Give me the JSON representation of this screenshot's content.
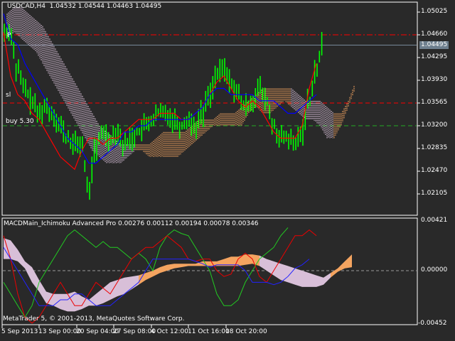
{
  "header": {
    "symbol": "USDCAD",
    "timeframe": "H4",
    "ohlc": "1.04532 1.04544 1.04463 1.04495"
  },
  "labels": {
    "p_marker": "P",
    "sl": "sl",
    "buy": "buy 5.30"
  },
  "price_axis": [
    "1.05025",
    "1.04660",
    "1.04295",
    "1.03930",
    "1.03565",
    "1.03200",
    "1.02835",
    "1.02470",
    "1.02105"
  ],
  "current_price": "1.04495",
  "indicator": {
    "title": "MACDMain_Ichimoku Advanced Pro 0.00276 0.00112 0.00194 0.00078 0.00346",
    "axis": [
      "0.00421",
      "0.00000",
      "-0.00452"
    ]
  },
  "copyright": "MetaTrader 5, © 2001-2013, MetaQuotes Software Corp.",
  "time_axis": [
    "5 Sep 2013",
    "13 Sep 00:00",
    "20 Sep 04:00",
    "27 Sep 08:00",
    "4 Oct 12:00",
    "11 Oct 16:00",
    "18 Oct 20:00"
  ],
  "colors": {
    "bg": "#292929",
    "bars": "#00ff00",
    "tenkan": "#ff0000",
    "kijun": "#0000ff",
    "pink": "#d8bfd8",
    "orange": "#f4a460",
    "grid": "#ffffff"
  },
  "chart_data": {
    "type": "line",
    "price_levels": {
      "dashdot_red": 1.0466,
      "current": 1.04495,
      "sl": 1.03565,
      "buy": 1.032
    },
    "price_ylim": [
      1.019,
      1.053
    ],
    "closes": [
      1.047,
      1.041,
      1.038,
      1.036,
      1.034,
      1.035,
      1.034,
      1.032,
      1.03,
      1.029,
      1.029,
      1.022,
      1.028,
      1.031,
      1.03,
      1.031,
      1.029,
      1.03,
      1.031,
      1.032,
      1.033,
      1.034,
      1.034,
      1.033,
      1.032,
      1.033,
      1.032,
      1.034,
      1.037,
      1.04,
      1.041,
      1.039,
      1.037,
      1.035,
      1.036,
      1.038,
      1.036,
      1.032,
      1.03,
      1.03,
      1.029,
      1.031,
      1.036,
      1.041,
      1.0449
    ],
    "tenkan": [
      1.047,
      1.04,
      1.037,
      1.036,
      1.034,
      1.033,
      1.031,
      1.029,
      1.027,
      1.026,
      1.025,
      1.028,
      1.03,
      1.03,
      1.029,
      1.03,
      1.03,
      1.031,
      1.032,
      1.033,
      1.033,
      1.033,
      1.034,
      1.034,
      1.034,
      1.033,
      1.033,
      1.034,
      1.035,
      1.037,
      1.039,
      1.04,
      1.038,
      1.036,
      1.035,
      1.036,
      1.035,
      1.033,
      1.031,
      1.03,
      1.03,
      1.03,
      1.032,
      1.038,
      1.042
    ],
    "kijun": [
      1.05,
      1.046,
      1.045,
      1.042,
      1.04,
      1.038,
      1.036,
      1.034,
      1.032,
      1.03,
      1.029,
      1.028,
      1.026,
      1.026,
      1.027,
      1.028,
      1.029,
      1.031,
      1.031,
      1.032,
      1.032,
      1.033,
      1.033,
      1.033,
      1.033,
      1.033,
      1.033,
      1.034,
      1.035,
      1.037,
      1.038,
      1.038,
      1.037,
      1.037,
      1.037,
      1.037,
      1.036,
      1.036,
      1.036,
      1.035,
      1.034,
      1.034,
      1.035,
      1.036,
      1.037
    ],
    "kumo_upper": [
      1.05,
      1.051,
      1.051,
      1.05,
      1.049,
      1.048,
      1.046,
      1.044,
      1.042,
      1.04,
      1.038,
      1.036,
      1.034,
      1.032,
      1.031,
      1.03,
      1.029,
      1.029,
      1.029,
      1.029,
      1.029,
      1.03,
      1.031,
      1.031,
      1.031,
      1.031,
      1.032,
      1.033,
      1.033,
      1.033,
      1.034,
      1.034,
      1.034,
      1.035,
      1.036,
      1.037,
      1.038,
      1.038,
      1.038,
      1.038,
      1.038,
      1.037,
      1.036,
      1.036,
      1.036,
      1.035,
      1.034,
      1.034,
      1.036,
      1.039
    ],
    "kumo_lower": [
      1.046,
      1.047,
      1.046,
      1.045,
      1.044,
      1.042,
      1.04,
      1.038,
      1.036,
      1.034,
      1.032,
      1.03,
      1.028,
      1.027,
      1.026,
      1.026,
      1.026,
      1.027,
      1.028,
      1.028,
      1.027,
      1.027,
      1.027,
      1.027,
      1.027,
      1.028,
      1.029,
      1.03,
      1.031,
      1.032,
      1.032,
      1.032,
      1.032,
      1.032,
      1.034,
      1.035,
      1.034,
      1.034,
      1.035,
      1.036,
      1.035,
      1.034,
      1.033,
      1.033,
      1.032,
      1.03,
      1.03,
      1.032,
      1.035,
      1.038
    ],
    "kumo_segments": [
      {
        "from": 0,
        "to": 18,
        "color": "pink"
      },
      {
        "from": 18,
        "to": 40,
        "color": "orange"
      },
      {
        "from": 40,
        "to": 46,
        "color": "pink"
      },
      {
        "from": 46,
        "to": 49,
        "color": "orange"
      }
    ],
    "macd_ylim": [
      -0.00452,
      0.00421
    ],
    "macd_green": [
      -0.001,
      -0.002,
      -0.003,
      -0.004,
      -0.003,
      -0.001,
      0.0,
      0.001,
      0.002,
      0.003,
      0.0035,
      0.003,
      0.0025,
      0.002,
      0.0025,
      0.002,
      0.002,
      0.0015,
      0.001,
      0.0015,
      0.001,
      0.0,
      0.002,
      0.003,
      0.0035,
      0.0032,
      0.003,
      0.002,
      0.001,
      0.0,
      -0.002,
      -0.003,
      -0.003,
      -0.0025,
      -0.001,
      0.0,
      0.001,
      0.0015,
      0.002,
      0.003,
      0.0037
    ],
    "macd_red": [
      0.003,
      0.001,
      -0.002,
      -0.004,
      -0.0045,
      -0.004,
      -0.003,
      -0.002,
      -0.001,
      -0.002,
      -0.003,
      -0.003,
      -0.002,
      -0.001,
      -0.0015,
      -0.002,
      -0.001,
      0.0,
      0.001,
      0.0015,
      0.002,
      0.002,
      0.0025,
      0.003,
      0.0025,
      0.002,
      0.001,
      0.0008,
      0.001,
      0.001,
      0.0,
      -0.0005,
      -0.0003,
      0.001,
      0.0015,
      0.001,
      -0.0005,
      -0.001,
      0.0,
      0.001,
      0.002,
      0.003,
      0.003,
      0.0035,
      0.003
    ],
    "macd_blue": [
      0.002,
      0.001,
      0.0,
      -0.001,
      -0.002,
      -0.003,
      -0.003,
      -0.003,
      -0.0025,
      -0.0025,
      -0.002,
      -0.002,
      -0.0025,
      -0.003,
      -0.003,
      -0.003,
      -0.0025,
      -0.002,
      -0.0015,
      -0.001,
      0.0,
      0.001,
      0.001,
      0.001,
      0.001,
      0.001,
      0.001,
      0.0008,
      0.0006,
      0.0003,
      0.0005,
      0.0005,
      0.0005,
      0.0005,
      0.0,
      -0.001,
      -0.001,
      -0.001,
      -0.0012,
      -0.001,
      -0.0005,
      0.0002,
      0.0005,
      0.001
    ],
    "macd_kumo_upper": [
      0.0028,
      0.0026,
      0.0018,
      0.0008,
      0.0003,
      -0.0008,
      -0.0018,
      -0.002,
      -0.002,
      -0.002,
      -0.0018,
      -0.0022,
      -0.0025,
      -0.002,
      -0.0015,
      -0.001,
      -0.0008,
      -0.0006,
      -0.0005,
      -0.0004,
      -0.0002,
      0.0,
      0.0003,
      0.0005,
      0.0006,
      0.0006,
      0.0006,
      0.0006,
      0.0008,
      0.0008,
      0.0008,
      0.001,
      0.0012,
      0.0012,
      0.0014,
      0.0014,
      0.0013,
      0.001,
      0.0008,
      0.0006,
      0.0004,
      0.0002,
      0.0,
      -0.0002,
      -0.0004,
      -0.0006,
      -0.0002,
      0.0002,
      0.0008,
      0.0014
    ],
    "macd_kumo_lower": [
      0.001,
      0.001,
      0.0008,
      0.0002,
      -0.001,
      -0.0018,
      -0.0028,
      -0.003,
      -0.0033,
      -0.0035,
      -0.0035,
      -0.0033,
      -0.003,
      -0.003,
      -0.0028,
      -0.0025,
      -0.0022,
      -0.002,
      -0.0016,
      -0.0012,
      -0.0008,
      -0.0005,
      -0.0002,
      0.0,
      0.0002,
      0.0003,
      0.0004,
      0.0004,
      0.0004,
      0.0004,
      0.0004,
      0.0004,
      0.0004,
      0.0004,
      0.0005,
      0.0006,
      0.0004,
      0.0,
      -0.0004,
      -0.0008,
      -0.001,
      -0.0012,
      -0.0014,
      -0.0014,
      -0.0014,
      -0.0012,
      -0.0006,
      -0.0001,
      0.0002,
      0.0003
    ],
    "macd_kumo_segments": [
      {
        "from": 0,
        "to": 19,
        "color": "pink"
      },
      {
        "from": 19,
        "to": 36,
        "color": "orange"
      },
      {
        "from": 36,
        "to": 46,
        "color": "pink"
      },
      {
        "from": 46,
        "to": 49,
        "color": "orange"
      }
    ]
  }
}
